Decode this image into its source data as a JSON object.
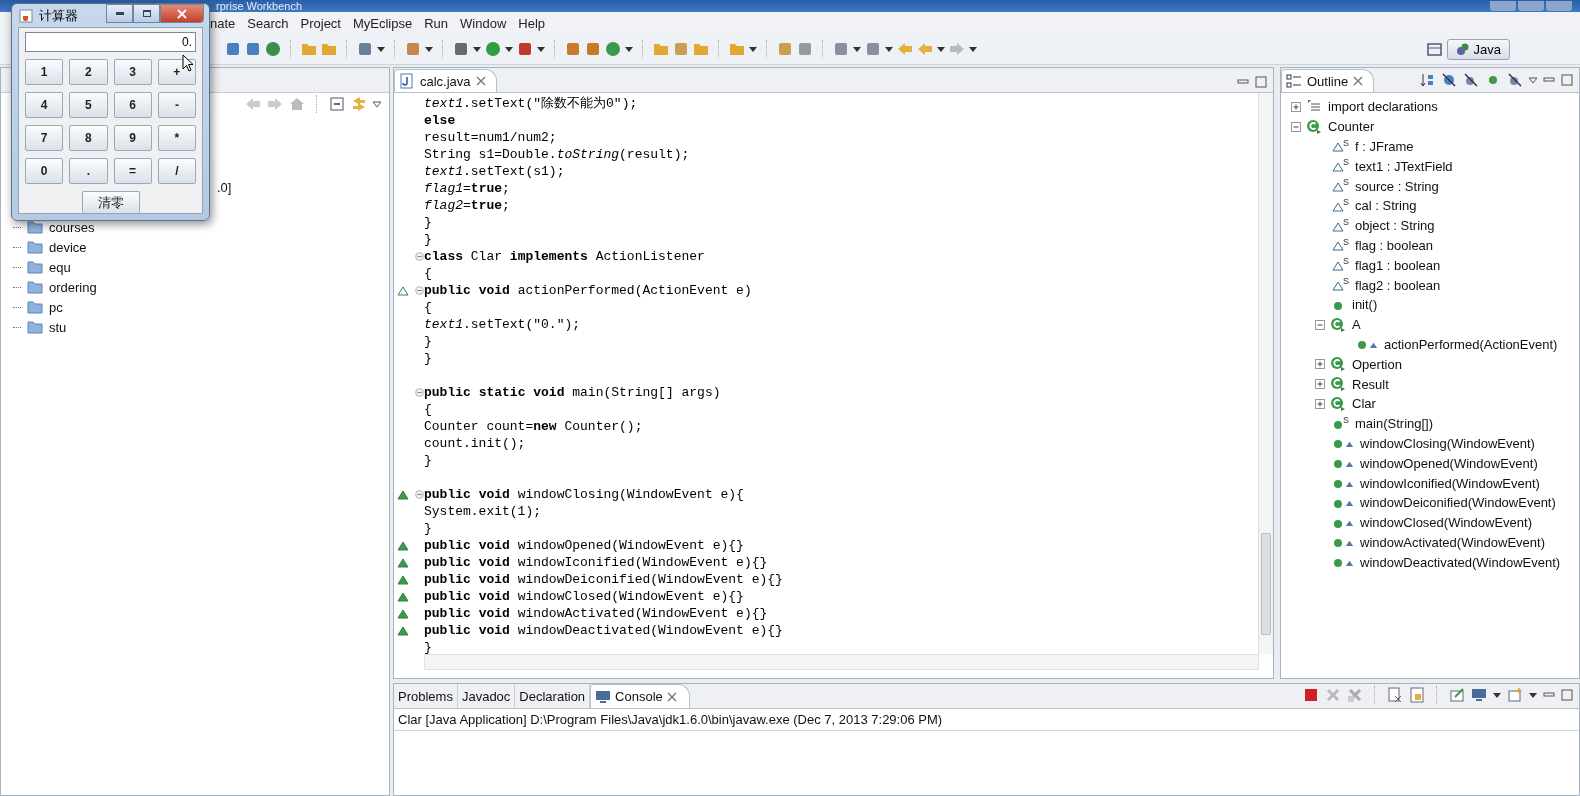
{
  "window": {
    "title": "rprise Workbench"
  },
  "menu": [
    "nate",
    "Search",
    "Project",
    "MyEclipse",
    "Run",
    "Window",
    "Help"
  ],
  "perspective": {
    "label": "Java",
    "selected": true
  },
  "package_explorer": {
    "obscured_label_tail": ".0]",
    "items": [
      {
        "label": "courses"
      },
      {
        "label": "device"
      },
      {
        "label": "equ"
      },
      {
        "label": "ordering"
      },
      {
        "label": "pc"
      },
      {
        "label": "stu"
      }
    ]
  },
  "editor": {
    "tabs": [
      {
        "label": "calc.java",
        "selected": true
      }
    ],
    "lines": [
      {
        "text": "*text1*.setText(\"除数不能为0\");"
      },
      {
        "text": "**else**"
      },
      {
        "text": "result=num1/num2;"
      },
      {
        "text": "String s1=Double.*toString*(result);"
      },
      {
        "text": "*text1*.setText(s1);"
      },
      {
        "text": "*flag1*=**true**;"
      },
      {
        "text": "*flag2*=**true**;"
      },
      {
        "text": "}"
      },
      {
        "text": "}"
      },
      {
        "text": "**class** Clar **implements** ActionListener",
        "fold": true
      },
      {
        "text": "{"
      },
      {
        "text": "**public** **void** actionPerformed(ActionEvent e)",
        "fold": true,
        "implements": true
      },
      {
        "text": "{"
      },
      {
        "text": "*text1*.setText(\"0.\");"
      },
      {
        "text": "}"
      },
      {
        "text": "}"
      },
      {
        "text": "**public** **static** **void** main(String[] args)",
        "fold": true,
        "blank_before": true
      },
      {
        "text": "{"
      },
      {
        "text": "Counter count=**new** Counter();"
      },
      {
        "text": "count.init();"
      },
      {
        "text": "}"
      },
      {
        "text": "**public** **void** windowClosing(WindowEvent e){",
        "fold": true,
        "overrides": true,
        "blank_before": true
      },
      {
        "text": "System.exit(1);"
      },
      {
        "text": "}"
      },
      {
        "text": "**public** **void** windowOpened(WindowEvent e){}",
        "overrides": true
      },
      {
        "text": "**public** **void** windowIconified(WindowEvent e){}",
        "overrides": true
      },
      {
        "text": "**public** **void** windowDeiconified(WindowEvent e){}",
        "overrides": true
      },
      {
        "text": "**public** **void** windowClosed(WindowEvent e){}",
        "overrides": true
      },
      {
        "text": "**public** **void** windowActivated(WindowEvent e){}",
        "overrides": true
      },
      {
        "text": "**public** **void** windowDeactivated(WindowEvent e){}",
        "overrides": true
      },
      {
        "text": "}"
      }
    ]
  },
  "outline": {
    "tab": {
      "label": "Outline",
      "selected": true
    },
    "items": [
      {
        "label": "import declarations",
        "kind": "imports",
        "expanded": false
      },
      {
        "label": "Counter",
        "kind": "class",
        "expanded": true,
        "children": [
          {
            "label": "f : JFrame",
            "kind": "field",
            "badge": "S"
          },
          {
            "label": "text1 : JTextField",
            "kind": "field",
            "badge": "S"
          },
          {
            "label": "source : String",
            "kind": "field",
            "badge": "S"
          },
          {
            "label": "cal : String",
            "kind": "field",
            "badge": "S"
          },
          {
            "label": "object : String",
            "kind": "field",
            "badge": "S"
          },
          {
            "label": "flag : boolean",
            "kind": "field",
            "badge": "S"
          },
          {
            "label": "flag1 : boolean",
            "kind": "field",
            "badge": "S"
          },
          {
            "label": "flag2 : boolean",
            "kind": "field",
            "badge": "S"
          },
          {
            "label": "init()",
            "kind": "method"
          },
          {
            "label": "A",
            "kind": "class",
            "expanded": true,
            "children": [
              {
                "label": "actionPerformed(ActionEvent)",
                "kind": "method",
                "marker": true
              }
            ]
          },
          {
            "label": "Opertion",
            "kind": "class",
            "expanded": false
          },
          {
            "label": "Result",
            "kind": "class",
            "expanded": false
          },
          {
            "label": "Clar",
            "kind": "class",
            "expanded": false
          },
          {
            "label": "main(String[])",
            "kind": "method",
            "badge": "S"
          },
          {
            "label": "windowClosing(WindowEvent)",
            "kind": "method",
            "marker": true
          },
          {
            "label": "windowOpened(WindowEvent)",
            "kind": "method",
            "marker": true
          },
          {
            "label": "windowIconified(WindowEvent)",
            "kind": "method",
            "marker": true
          },
          {
            "label": "windowDeiconified(WindowEvent)",
            "kind": "method",
            "marker": true
          },
          {
            "label": "windowClosed(WindowEvent)",
            "kind": "method",
            "marker": true
          },
          {
            "label": "windowActivated(WindowEvent)",
            "kind": "method",
            "marker": true
          },
          {
            "label": "windowDeactivated(WindowEvent)",
            "kind": "method",
            "marker": true
          }
        ]
      }
    ]
  },
  "bottom": {
    "tabs": [
      {
        "label": "Problems",
        "selected": false
      },
      {
        "label": "Javadoc",
        "selected": false
      },
      {
        "label": "Declaration",
        "selected": false
      },
      {
        "label": "Console",
        "selected": true
      }
    ],
    "console_header": "Clar [Java Application] D:\\Program Files\\Java\\jdk1.6.0\\bin\\javaw.exe (Dec 7, 2013 7:29:06 PM)"
  },
  "calculator": {
    "title": "计算器",
    "display": "0.",
    "keys": [
      "1",
      "2",
      "3",
      "+",
      "4",
      "5",
      "6",
      "-",
      "7",
      "8",
      "9",
      "*",
      "0",
      ".",
      "=",
      "/"
    ],
    "clear": "清零"
  }
}
